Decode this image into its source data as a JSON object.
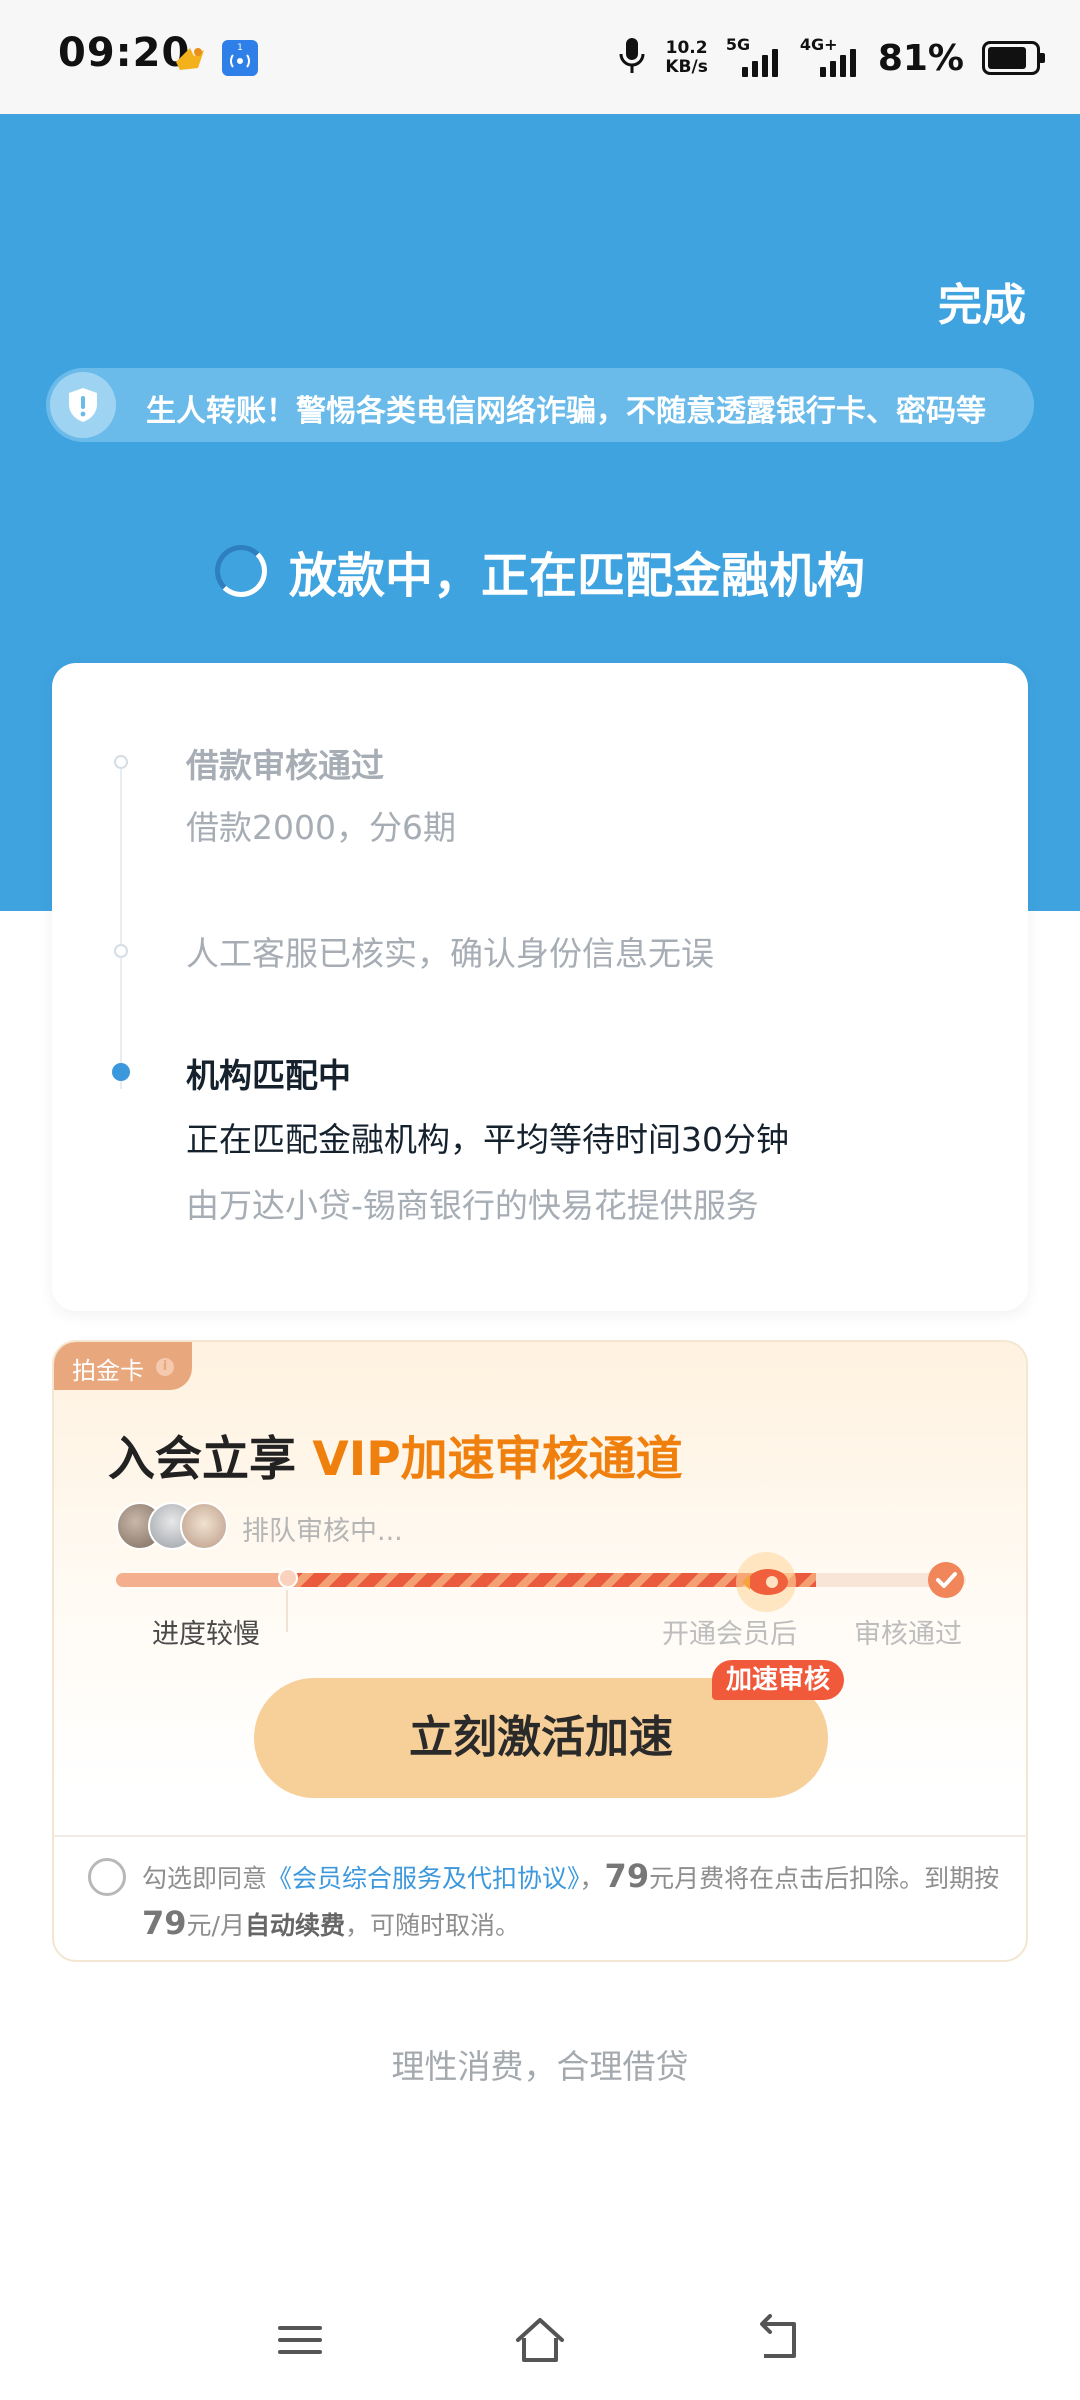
{
  "status_bar": {
    "time": "09:20",
    "net_speed_value": "10.2",
    "net_speed_unit": "KB/s",
    "sim1_label": "5G",
    "sim2_label": "4G+",
    "battery_percent": "81%",
    "battery_level": 0.81,
    "icons": [
      "app-notification-icon",
      "hotspot-icon",
      "microphone-icon",
      "signal-icon",
      "battery-icon"
    ]
  },
  "header": {
    "done_label": "完成",
    "notice_text": "生人转账！警惕各类电信网络诈骗，不随意透露银行卡、密码等",
    "loading_title": "放款中，正在匹配金融机构"
  },
  "timeline": {
    "step1": {
      "title": "借款审核通过",
      "detail": "借款2000，分6期"
    },
    "step2": {
      "title": "人工客服已核实，确认身份信息无误"
    },
    "step3": {
      "title": "机构匹配中",
      "detail": "正在匹配金融机构，平均等待时间30分钟",
      "provider": "由万达小贷-锡商银行的快易花提供服务"
    }
  },
  "vip": {
    "tag": "拍金卡",
    "tag_info": "i",
    "heading_prefix": "入会立享 ",
    "heading_highlight": "VIP加速审核通道",
    "queue_text": "排队审核中...",
    "progress_label_slow": "进度较慢",
    "progress_label_member": "开通会员后",
    "progress_label_done": "审核通过",
    "cta_label": "立刻激活加速",
    "cta_badge": "加速审核",
    "agreement": {
      "prefix": "勾选即同意",
      "link": "《会员综合服务及代扣协议》",
      "sep": "，",
      "fee1": "79",
      "mid1": "元月费将在点击后扣除。到期按",
      "fee2": "79",
      "mid2": "元/月",
      "auto": "自动续费",
      "suffix": "，可随时取消。"
    }
  },
  "footer": {
    "slogan": "理性消费，合理借贷"
  },
  "colors": {
    "brand_blue": "#3fa3e0",
    "accent_orange": "#f0800e",
    "cta_bg": "#f7cf98",
    "badge_red": "#f05a3a"
  }
}
